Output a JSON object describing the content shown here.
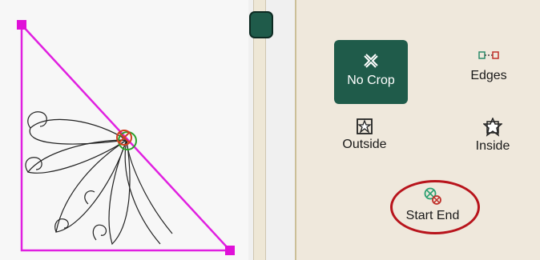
{
  "toolbar": {
    "no_crop": {
      "label": "No Crop",
      "icon": "no-crop-icon",
      "selected": true
    },
    "edges": {
      "label": "Edges",
      "icon": "edges-icon"
    },
    "outside": {
      "label": "Outside",
      "icon": "outside-icon"
    },
    "inside": {
      "label": "Inside",
      "icon": "inside-icon"
    },
    "start_end": {
      "label": "Start End",
      "icon": "start-end-icon",
      "highlighted": true
    }
  },
  "colors": {
    "selected_button": "#1f5b4a",
    "boundary": "#e020e0",
    "handle": "#e010d8",
    "highlight_ring": "#b8141c",
    "panel_background": "#efe8dc"
  }
}
